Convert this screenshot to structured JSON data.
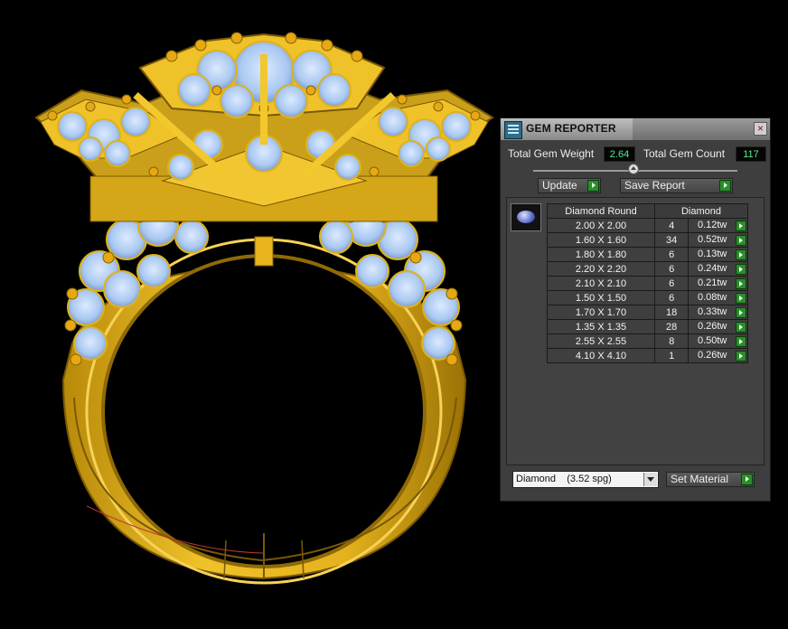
{
  "window": {
    "title": "GEM REPORTER",
    "close_symbol": "×"
  },
  "summary": {
    "weight_label": "Total Gem Weight",
    "weight_value": "2.64",
    "count_label": "Total Gem Count",
    "count_value": "117"
  },
  "buttons": {
    "update_label": "Update",
    "save_report_label": "Save Report",
    "set_material_label": "Set Material"
  },
  "gem_table": {
    "col_shape": "Diamond Round",
    "col_material": "Diamond",
    "rows": [
      {
        "size": "2.00 X 2.00",
        "count": "4",
        "weight": "0.12tw"
      },
      {
        "size": "1.60 X 1.60",
        "count": "34",
        "weight": "0.52tw"
      },
      {
        "size": "1.80 X 1.80",
        "count": "6",
        "weight": "0.13tw"
      },
      {
        "size": "2.20 X 2.20",
        "count": "6",
        "weight": "0.24tw"
      },
      {
        "size": "2.10 X 2.10",
        "count": "6",
        "weight": "0.21tw"
      },
      {
        "size": "1.50 X 1.50",
        "count": "6",
        "weight": "0.08tw"
      },
      {
        "size": "1.70 X 1.70",
        "count": "18",
        "weight": "0.33tw"
      },
      {
        "size": "1.35 X 1.35",
        "count": "28",
        "weight": "0.26tw"
      },
      {
        "size": "2.55 X 2.55",
        "count": "8",
        "weight": "0.50tw"
      },
      {
        "size": "4.10 X 4.10",
        "count": "1",
        "weight": "0.26tw"
      }
    ]
  },
  "material_select": {
    "value": "Diamond    (3.52 spg)"
  },
  "icons": {
    "app": "gem-reporter-app-icon",
    "gem": "round-diamond-icon",
    "go": "green-play-arrow-icon",
    "dropdown": "chevron-down-icon"
  },
  "colors": {
    "metal": "#e7b51f",
    "metal_dark": "#a87a08",
    "gems": "#b9d6f5",
    "value_text": "#4df08a",
    "go_button": "#2d8c2d"
  }
}
